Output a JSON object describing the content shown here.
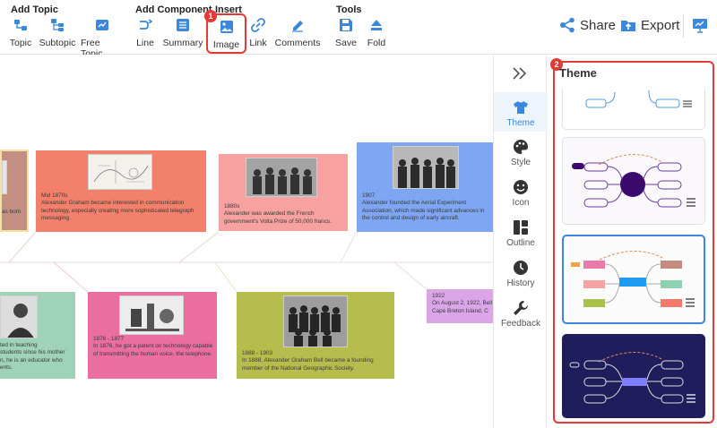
{
  "toolbar": {
    "groups": {
      "add_topic": "Add Topic",
      "add_component": "Add Component",
      "insert": "Insert",
      "tools": "Tools"
    },
    "buttons": {
      "topic": "Topic",
      "subtopic": "Subtopic",
      "free_topic": "Free Topic",
      "line": "Line",
      "summary": "Summary",
      "image": "Image",
      "link": "Link",
      "comments": "Comments",
      "save": "Save",
      "fold": "Fold"
    },
    "share": "Share",
    "export": "Export",
    "accent_color": "#3a87db",
    "highlight_color": "#e53935"
  },
  "steps": {
    "step1": "1",
    "step2": "2"
  },
  "timeline": {
    "cards": [
      {
        "text": "as born",
        "color": "#c48f83"
      },
      {
        "text": "Mid 1870s\nAlexander Graham became interested in communication technology, especially creating more sophisticated telegraph messaging.",
        "color": "#f3806a"
      },
      {
        "text": "1880s\nAlexander was awarded the French government's Volta Prize of 50,000 francs.",
        "color": "#f7a1a0"
      },
      {
        "text": "1907\nAlexander founded the Aerial Experiment Association, which made significant advances in the control and design of early aircraft.",
        "color": "#7ea6f2"
      },
      {
        "text": "ted in teaching\nstudents since his mother\nn, he is an educator who\nents.",
        "color": "#9fd3b9"
      },
      {
        "text": "1876 - 1877\nIn 1876, he got a patent on technology capable of transmitting the human voice, the telephone.",
        "color": "#ea6fa0"
      },
      {
        "text": "1888 - 1903\nIn 1888, Alexander Graham Bell became a founding member of the National Geographic Society.",
        "color": "#b6bd4d"
      },
      {
        "text": "1922\nOn August 2, 1922, Bell\nCape Breton Island, C",
        "color": "#dba6e8"
      }
    ]
  },
  "sidebar": {
    "items": [
      {
        "label": "Theme",
        "icon": "shirt-icon"
      },
      {
        "label": "Style",
        "icon": "palette-icon"
      },
      {
        "label": "Icon",
        "icon": "smiley-icon"
      },
      {
        "label": "Outline",
        "icon": "outline-icon"
      },
      {
        "label": "History",
        "icon": "clock-icon"
      },
      {
        "label": "Feedback",
        "icon": "wrench-icon"
      }
    ]
  },
  "theme_panel": {
    "title": "Theme",
    "themes": [
      {
        "name": "theme-light-blue",
        "bg": "#ffffff"
      },
      {
        "name": "theme-purple",
        "bg": "#faf8fb"
      },
      {
        "name": "theme-colorful",
        "bg": "#fbfbfb",
        "selected": true
      },
      {
        "name": "theme-dark",
        "bg": "#1f1d5b"
      }
    ]
  }
}
